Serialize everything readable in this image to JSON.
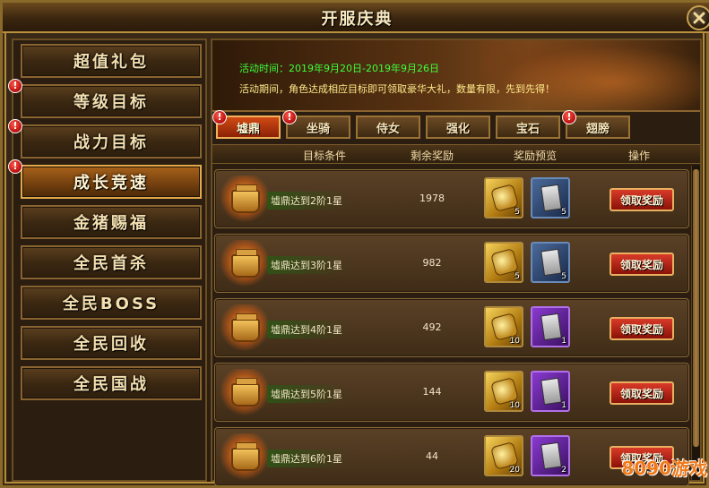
{
  "window": {
    "title": "开服庆典"
  },
  "sidebar": {
    "items": [
      {
        "label": "超值礼包",
        "alert": false,
        "active": false
      },
      {
        "label": "等级目标",
        "alert": true,
        "active": false
      },
      {
        "label": "战力目标",
        "alert": true,
        "active": false
      },
      {
        "label": "成长竞速",
        "alert": true,
        "active": true
      },
      {
        "label": "金猪赐福",
        "alert": false,
        "active": false
      },
      {
        "label": "全民首杀",
        "alert": false,
        "active": false
      },
      {
        "label": "全民BOSS",
        "alert": false,
        "active": false
      },
      {
        "label": "全民回收",
        "alert": false,
        "active": false
      },
      {
        "label": "全民国战",
        "alert": false,
        "active": false
      }
    ]
  },
  "banner": {
    "date": "活动时间：2019年9月20日-2019年9月26日",
    "description": "活动期间，角色达成相应目标即可领取豪华大礼，数量有限，先到先得！"
  },
  "tabs": [
    {
      "label": "墟鼎",
      "alert": true,
      "active": true
    },
    {
      "label": "坐骑",
      "alert": true,
      "active": false
    },
    {
      "label": "侍女",
      "alert": false,
      "active": false
    },
    {
      "label": "强化",
      "alert": false,
      "active": false
    },
    {
      "label": "宝石",
      "alert": false,
      "active": false
    },
    {
      "label": "翅膀",
      "alert": true,
      "active": false
    }
  ],
  "table": {
    "headers": [
      "目标条件",
      "剩余奖励",
      "奖励预览",
      "操作"
    ],
    "rows": [
      {
        "condition": "墟鼎达到2阶1星",
        "remaining": "1978",
        "rewards": [
          {
            "type": "gold",
            "count": "5"
          },
          {
            "type": "blue",
            "count": "5"
          }
        ],
        "action": "领取奖励"
      },
      {
        "condition": "墟鼎达到3阶1星",
        "remaining": "982",
        "rewards": [
          {
            "type": "gold",
            "count": "5"
          },
          {
            "type": "blue",
            "count": "5"
          }
        ],
        "action": "领取奖励"
      },
      {
        "condition": "墟鼎达到4阶1星",
        "remaining": "492",
        "rewards": [
          {
            "type": "gold",
            "count": "10"
          },
          {
            "type": "purple",
            "count": "1"
          }
        ],
        "action": "领取奖励"
      },
      {
        "condition": "墟鼎达到5阶1星",
        "remaining": "144",
        "rewards": [
          {
            "type": "gold",
            "count": "10"
          },
          {
            "type": "purple",
            "count": "1"
          }
        ],
        "action": "领取奖励"
      },
      {
        "condition": "墟鼎达到6阶1星",
        "remaining": "44",
        "rewards": [
          {
            "type": "gold",
            "count": "20"
          },
          {
            "type": "purple",
            "count": "2"
          }
        ],
        "action": "领取奖励"
      }
    ]
  },
  "watermark": {
    "text": "8090游戏"
  },
  "colors": {
    "accent": "#d14a14",
    "date_green": "#3cff3c",
    "desc_yellow": "#ffe98a",
    "alert_red": "#b80d0d"
  }
}
